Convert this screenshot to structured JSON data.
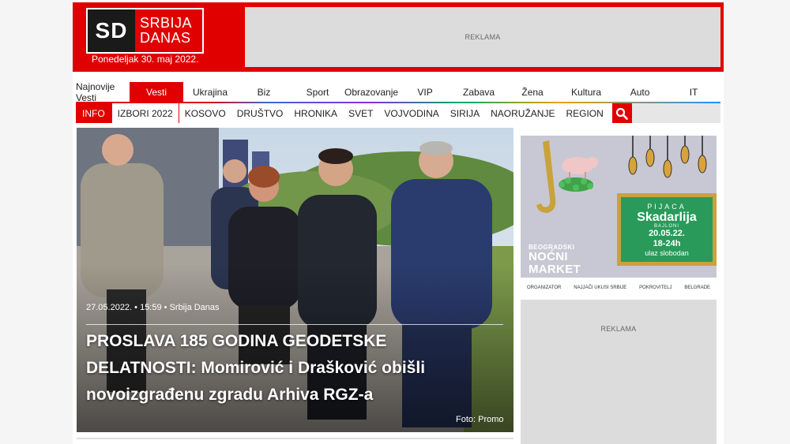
{
  "header": {
    "logo_short": "SD",
    "logo_line1": "SRBIJA",
    "logo_line2": "DANAS",
    "date": "Ponedeljak 30. maj 2022.",
    "ad_label": "REKLAMA"
  },
  "nav_primary": [
    {
      "label": "Najnovije Vesti"
    },
    {
      "label": "Vesti",
      "active": true
    },
    {
      "label": "Ukrajina"
    },
    {
      "label": "Biz"
    },
    {
      "label": "Sport"
    },
    {
      "label": "Obrazovanje"
    },
    {
      "label": "VIP"
    },
    {
      "label": "Zabava"
    },
    {
      "label": "Žena"
    },
    {
      "label": "Kultura"
    },
    {
      "label": "Auto"
    },
    {
      "label": "IT"
    }
  ],
  "nav_secondary": [
    {
      "label": "INFO"
    },
    {
      "label": "IZBORI 2022"
    },
    {
      "label": "KOSOVO"
    },
    {
      "label": "DRUŠTVO"
    },
    {
      "label": "HRONIKA"
    },
    {
      "label": "SVET"
    },
    {
      "label": "VOJVODINA"
    },
    {
      "label": "SIRIJA"
    },
    {
      "label": "NAORUŽANJE"
    },
    {
      "label": "REGION"
    }
  ],
  "search": {
    "icon": "search-icon"
  },
  "hero": {
    "meta": "27.05.2022. • 15:59 • Srbija Danas",
    "title": "PROSLAVA 185 GODINA GEODETSKE DELATNOSTI: Momirović i Drašković obišli novoizgrađenu zgradu Arhiva RGZ-a",
    "credit": "Foto: Promo"
  },
  "promo": {
    "left_small": "BEOGRADSKI",
    "left_big1": "NOĆNI",
    "left_big2": "MARKET",
    "frame_line1": "PIJACA",
    "frame_line2": "Skadarlija",
    "frame_line3": "BAJLONI",
    "frame_line4": "20.05.22.",
    "frame_line5": "18-24h",
    "frame_line6": "ulaz slobodan",
    "footer_1": "ORGANIZATOR",
    "footer_2": "NAJJAČI UKUSI SRBIJE",
    "footer_3": "POKROVITELJ",
    "footer_4": "BELGRADE"
  },
  "ad_right_label": "REKLAMA",
  "colors": {
    "brand_red": "#e10000",
    "logo_dark": "#1a1a1a",
    "ad_gray": "#dcdcdc",
    "promo_bg": "#c8c8d4",
    "frame_gold": "#c9a23c",
    "frame_green": "#2a9a5a"
  }
}
